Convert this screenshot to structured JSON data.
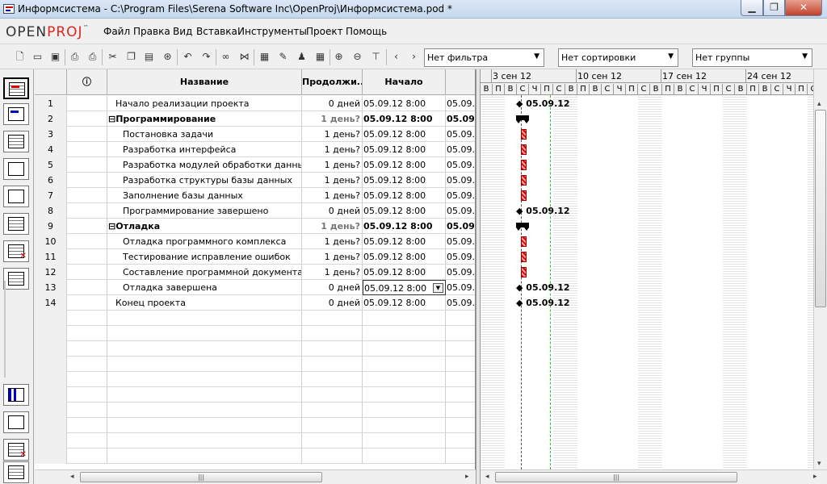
{
  "window": {
    "title": "Информсистема - C:\\Program Files\\Serena Software Inc\\OpenProj\\Информсистема.pod *"
  },
  "logo": {
    "part1": "OPEN",
    "part2": "PROJ",
    "tm": "™"
  },
  "menu": [
    "Файл",
    "Правка",
    "Вид",
    "Вставка",
    "Инструменты",
    "Проект",
    "Помощь"
  ],
  "toolbar": {
    "filter": "Нет фильтра",
    "sort": "Нет сортировки",
    "group": "Нет группы"
  },
  "columns": {
    "info_icon": "ⓘ",
    "name": "Название",
    "duration": "Продолжи...",
    "start": "Начало"
  },
  "tasks": [
    {
      "id": "1",
      "name": "Начало реализации проекта",
      "duration": "0 дней",
      "start": "05.09.12 8:00",
      "finish": "05.09.",
      "level": 1,
      "summary": false
    },
    {
      "id": "2",
      "name": "Программирование",
      "duration": "1 день?",
      "start": "05.09.12 8:00",
      "finish": "05.09.",
      "level": 1,
      "summary": true
    },
    {
      "id": "3",
      "name": "Постановка задачи",
      "duration": "1 день?",
      "start": "05.09.12 8:00",
      "finish": "05.09.",
      "level": 2,
      "summary": false
    },
    {
      "id": "4",
      "name": "Разработка интерфейса",
      "duration": "1 день?",
      "start": "05.09.12 8:00",
      "finish": "05.09.",
      "level": 2,
      "summary": false
    },
    {
      "id": "5",
      "name": "Разработка модулей обработки данных",
      "duration": "1 день?",
      "start": "05.09.12 8:00",
      "finish": "05.09.",
      "level": 2,
      "summary": false
    },
    {
      "id": "6",
      "name": "Разработка структуры  базы данных",
      "duration": "1 день?",
      "start": "05.09.12 8:00",
      "finish": "05.09.",
      "level": 2,
      "summary": false
    },
    {
      "id": "7",
      "name": "Заполнение базы данных",
      "duration": "1 день?",
      "start": "05.09.12 8:00",
      "finish": "05.09.",
      "level": 2,
      "summary": false
    },
    {
      "id": "8",
      "name": "Программирование завершено",
      "duration": "0 дней",
      "start": "05.09.12 8:00",
      "finish": "05.09.",
      "level": 2,
      "summary": false
    },
    {
      "id": "9",
      "name": "Отладка",
      "duration": "1 день?",
      "start": "05.09.12 8:00",
      "finish": "05.09.",
      "level": 1,
      "summary": true
    },
    {
      "id": "10",
      "name": "Отладка программного комплекса",
      "duration": "1 день?",
      "start": "05.09.12 8:00",
      "finish": "05.09.",
      "level": 2,
      "summary": false
    },
    {
      "id": "11",
      "name": "Тестирование исправление ошибок",
      "duration": "1 день?",
      "start": "05.09.12 8:00",
      "finish": "05.09.",
      "level": 2,
      "summary": false
    },
    {
      "id": "12",
      "name": "Составление программной документации",
      "duration": "1 день?",
      "start": "05.09.12 8:00",
      "finish": "05.09.",
      "level": 2,
      "summary": false
    },
    {
      "id": "13",
      "name": "Отладка завершена",
      "duration": "0 дней",
      "start": "05.09.12 8:00",
      "finish": "05.09.",
      "level": 2,
      "summary": false,
      "editing": true
    },
    {
      "id": "14",
      "name": "Конец проекта",
      "duration": "0 дней",
      "start": "05.09.12 8:00",
      "finish": "05.09.",
      "level": 1,
      "summary": false
    }
  ],
  "gantt": {
    "weeks": [
      "3 сен 12",
      "10 сен 12",
      "17 сен 12",
      "24 сен 12"
    ],
    "days": [
      "В",
      "П",
      "В",
      "С",
      "Ч",
      "П",
      "С",
      "В",
      "П",
      "В",
      "С",
      "Ч",
      "П",
      "С",
      "В",
      "П",
      "В",
      "С",
      "Ч",
      "П",
      "С",
      "В",
      "П",
      "В",
      "С",
      "Ч",
      "П",
      "С",
      "В",
      "П",
      "В",
      "С",
      "Ч",
      "П",
      "С",
      "В",
      "П"
    ],
    "milestone_label": "05.09.12",
    "rows": [
      "milestone",
      "summary",
      "bar",
      "bar",
      "bar",
      "bar",
      "bar",
      "milestone",
      "summary",
      "bar",
      "bar",
      "bar",
      "milestone",
      "milestone"
    ]
  },
  "scroll": {
    "grip": "|||"
  }
}
